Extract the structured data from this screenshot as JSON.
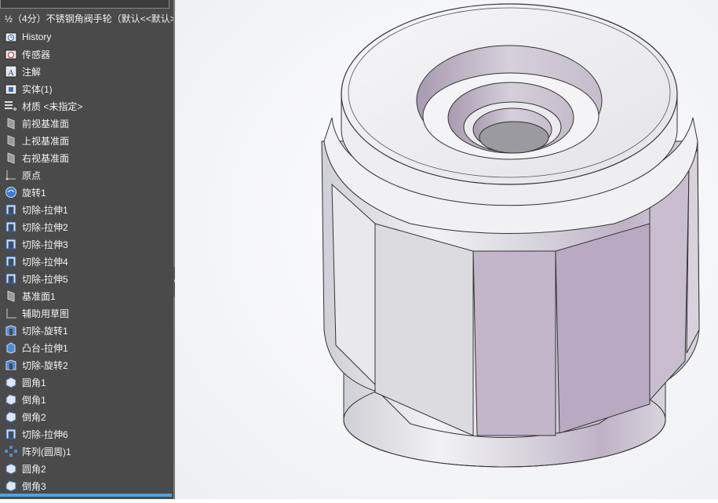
{
  "window": {
    "title": "SolidWorks part view"
  },
  "tree": {
    "root_label": "½（4分）不锈钢角阀手轮（默认<<默认>",
    "items": [
      {
        "label": "History",
        "icon": "history-icon"
      },
      {
        "label": "传感器",
        "icon": "sensor-icon"
      },
      {
        "label": "注解",
        "icon": "annotation-icon"
      },
      {
        "label": "实体(1)",
        "icon": "solid-bodies-icon"
      },
      {
        "label": "材质 <未指定>",
        "icon": "material-icon"
      },
      {
        "label": "前视基准面",
        "icon": "plane-icon"
      },
      {
        "label": "上视基准面",
        "icon": "plane-icon"
      },
      {
        "label": "右视基准面",
        "icon": "plane-icon"
      },
      {
        "label": "原点",
        "icon": "origin-icon"
      },
      {
        "label": "旋转1",
        "icon": "revolve-icon"
      },
      {
        "label": "切除-拉伸1",
        "icon": "cut-extrude-icon"
      },
      {
        "label": "切除-拉伸2",
        "icon": "cut-extrude-icon"
      },
      {
        "label": "切除-拉伸3",
        "icon": "cut-extrude-icon"
      },
      {
        "label": "切除-拉伸4",
        "icon": "cut-extrude-icon"
      },
      {
        "label": "切除-拉伸5",
        "icon": "cut-extrude-icon"
      },
      {
        "label": "基准面1",
        "icon": "plane-icon"
      },
      {
        "label": "辅助用草图",
        "icon": "sketch-icon"
      },
      {
        "label": "切除-旋转1",
        "icon": "cut-revolve-icon"
      },
      {
        "label": "凸台-拉伸1",
        "icon": "boss-extrude-icon"
      },
      {
        "label": "切除-旋转2",
        "icon": "cut-revolve-icon"
      },
      {
        "label": "圆角1",
        "icon": "fillet-icon"
      },
      {
        "label": "倒角1",
        "icon": "chamfer-icon"
      },
      {
        "label": "倒角2",
        "icon": "chamfer-icon"
      },
      {
        "label": "切除-拉伸6",
        "icon": "cut-extrude-icon"
      },
      {
        "label": "阵列(圆周)1",
        "icon": "circular-pattern-icon"
      },
      {
        "label": "圆角2",
        "icon": "fillet-icon"
      },
      {
        "label": "倒角3",
        "icon": "chamfer-icon"
      }
    ]
  },
  "colors": {
    "tree_bg": "#4a4a4a",
    "accent": "#4ea3e6",
    "model_base": "#e0e0e4",
    "model_purple": "#b6a4be"
  }
}
